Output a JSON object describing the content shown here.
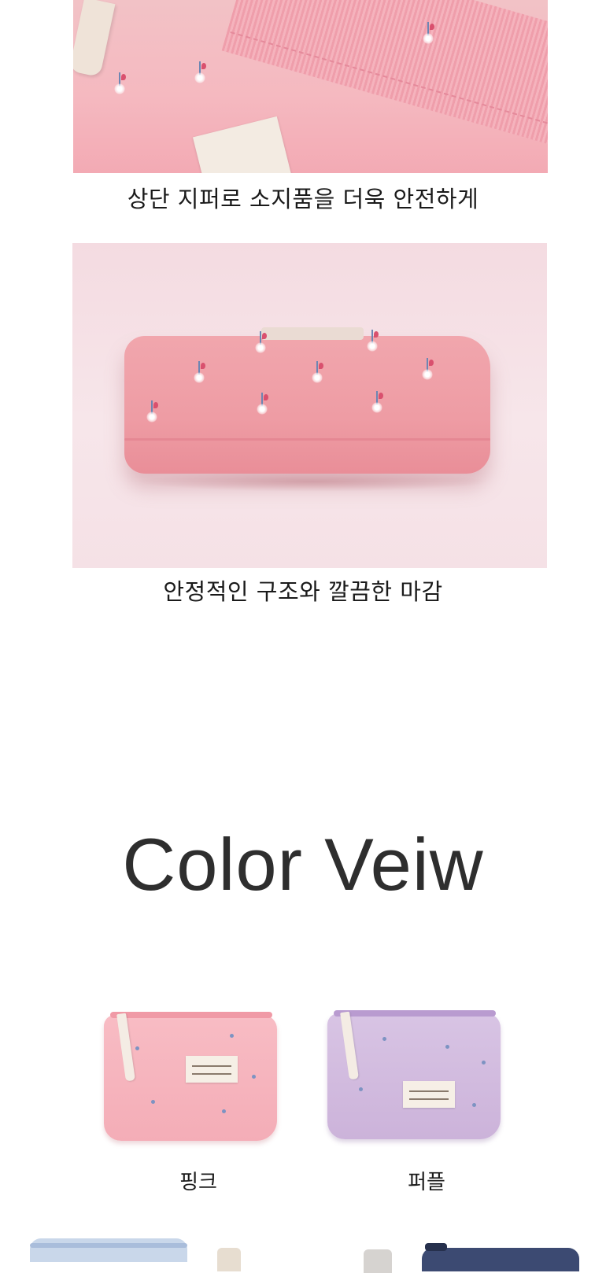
{
  "captions": {
    "zipper": "상단 지퍼로 소지품을 더욱 안전하게",
    "structure": "안정적인 구조와 깔끔한 마감"
  },
  "heading": "Color Veiw",
  "colors": [
    {
      "label": "핑크",
      "swatch": "#f4adb7"
    },
    {
      "label": "퍼플",
      "swatch": "#ccb3da"
    }
  ],
  "partial_row_colors": [
    "#c9d7ea",
    "#3c4a72"
  ]
}
